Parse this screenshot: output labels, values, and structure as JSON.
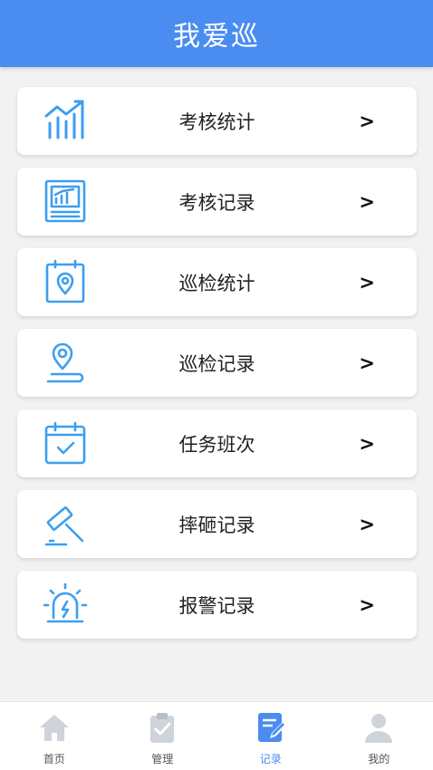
{
  "header": {
    "title": "我爱巡"
  },
  "colors": {
    "brand": "#4a8cf0",
    "icon": "#3d9ef0",
    "tab_inactive": "#cfd3da"
  },
  "menu": {
    "arrow": ">",
    "items": [
      {
        "label": "考核统计",
        "icon": "bar-chart-trend-icon"
      },
      {
        "label": "考核记录",
        "icon": "report-chart-icon"
      },
      {
        "label": "巡检统计",
        "icon": "location-board-icon"
      },
      {
        "label": "巡检记录",
        "icon": "map-pin-icon"
      },
      {
        "label": "任务班次",
        "icon": "calendar-check-icon"
      },
      {
        "label": "摔砸记录",
        "icon": "gavel-icon"
      },
      {
        "label": "报警记录",
        "icon": "alarm-light-icon"
      }
    ]
  },
  "tabbar": {
    "tabs": [
      {
        "label": "首页",
        "icon": "home-icon",
        "active": false
      },
      {
        "label": "管理",
        "icon": "clipboard-check-icon",
        "active": false
      },
      {
        "label": "记录",
        "icon": "edit-note-icon",
        "active": true
      },
      {
        "label": "我的",
        "icon": "user-icon",
        "active": false
      }
    ]
  }
}
